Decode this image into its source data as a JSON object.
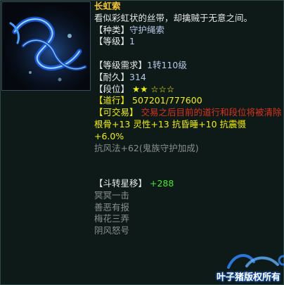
{
  "item": {
    "name": "长虹索",
    "description": "看似彩虹状的丝带，却擒贼于无意之间。",
    "type_label": "【种类】",
    "type_value": "守护绳索",
    "level_label": "【等级】",
    "level_value": "1",
    "req_label": "【等级需求】",
    "req_value": "1转110级",
    "dura_label": "【耐久】",
    "dura_value": "314",
    "rank_label": "【段位】",
    "rank_filled": "★★",
    "rank_empty": "☆☆☆",
    "rank_filled_count": 2,
    "rank_total": 5,
    "dao_label": "【道行】",
    "dao_value": "507201/777600",
    "trade_label": "【可交易】",
    "trade_value": "交易之后目前的道行和段位将被清除",
    "stats_line1": "根骨+13  灵性+13  抗昏睡+10  抗震慑",
    "stats_line2": "+6.0%",
    "resist_line": "抗风法+62(鬼族守护加成)",
    "star_move_label": "【斗转星移】",
    "star_move_value": "+288",
    "skills": [
      "冥冥一击",
      "善恶有报",
      "梅花三弄",
      "阴风怒号"
    ]
  },
  "watermark": {
    "text": "叶子猪版权所有"
  },
  "colors": {
    "name": "#f2c531",
    "label_bracket": "#e8e8e8",
    "red": "#e0301c",
    "green": "#42e82a",
    "yellow": "#f4f000",
    "gray": "#8a8f8c",
    "background": "#0d1a18"
  },
  "icons": {
    "item_image": "rainbow-rope-ribbon-icon",
    "watermark_logo": "yezizhu-logo-icon"
  }
}
